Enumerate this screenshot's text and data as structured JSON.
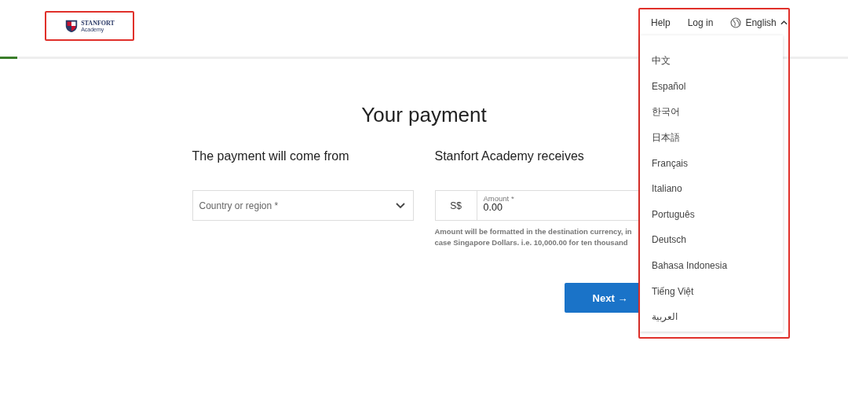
{
  "logo": {
    "name": "STANFORT",
    "subtitle": "Academy",
    "highlighted": true
  },
  "progress": {
    "level": 0.02
  },
  "nav": {
    "highlighted": true,
    "links": [
      "Help",
      "Log in"
    ],
    "language": {
      "label": "English",
      "expanded": true
    }
  },
  "language_menu": [
    {
      "label": "中文"
    },
    {
      "label": "Español"
    },
    {
      "label": "한국어"
    },
    {
      "label": "日本語"
    },
    {
      "label": "Français"
    },
    {
      "label": "Italiano"
    },
    {
      "label": "Português"
    },
    {
      "label": "Deutsch"
    },
    {
      "label": "Bahasa Indonesia"
    },
    {
      "label": "Tiếng Việt"
    },
    {
      "label": "العربية"
    }
  ],
  "title": "Your payment",
  "from": {
    "heading": "The payment will come from",
    "country_field": {
      "placeholder": "Country or region *"
    }
  },
  "to": {
    "heading": "Stanfort Academy receives",
    "currency": "S$",
    "amount_field": {
      "label": "Amount *",
      "value": "0.00"
    },
    "help": [
      "Amount will be formatted in the destination currency, in",
      "case Singapore Dollars. i.e. 10,000.00 for ten thousand"
    ]
  },
  "next_button": {
    "label": "Next",
    "arrow": "→"
  }
}
